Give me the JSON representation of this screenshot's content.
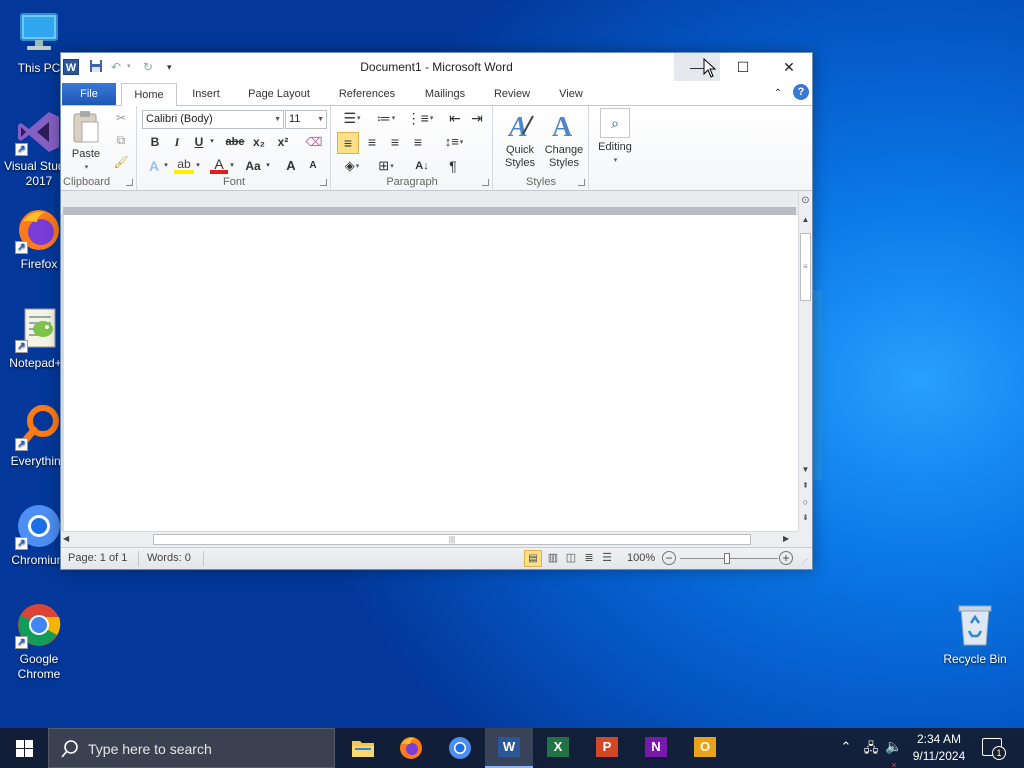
{
  "desktop": {
    "icons": [
      {
        "label": "This PC"
      },
      {
        "label": "Visual Studio\n2017"
      },
      {
        "label": "Firefox"
      },
      {
        "label": "Notepad++"
      },
      {
        "label": "Everything"
      },
      {
        "label": "Chromium"
      },
      {
        "label": "Google\nChrome"
      },
      {
        "label": "Recycle Bin"
      }
    ]
  },
  "window": {
    "title": "Document1  -  Microsoft Word",
    "tabs": [
      "File",
      "Home",
      "Insert",
      "Page Layout",
      "References",
      "Mailings",
      "Review",
      "View"
    ],
    "ribbon": {
      "clipboard": {
        "label": "Clipboard",
        "paste": "Paste"
      },
      "font": {
        "label": "Font",
        "font_name": "Calibri (Body)",
        "font_size": "11",
        "bold": "B",
        "italic": "I",
        "underline": "U",
        "strike": "abe",
        "subscript": "x₂",
        "superscript": "x²",
        "grow": "A",
        "shrink": "A",
        "change_case": "Aa",
        "font_color": "A",
        "text_effects": "A"
      },
      "paragraph": {
        "label": "Paragraph",
        "pilcrow": "¶"
      },
      "styles": {
        "label": "Styles",
        "quick_styles": "Quick\nStyles",
        "change_styles": "Change\nStyles"
      },
      "editing": {
        "label": "Editing"
      }
    },
    "status": {
      "page": "Page: 1 of 1",
      "words": "Words: 0",
      "zoom": "100%"
    }
  },
  "taskbar": {
    "search_placeholder": "Type here to search",
    "time": "2:34 AM",
    "date": "9/11/2024",
    "notification_count": "1"
  },
  "colors": {
    "word_blue": "#2b579a",
    "file_tab": "#2a66c8",
    "desktop": "#0a78e6"
  }
}
